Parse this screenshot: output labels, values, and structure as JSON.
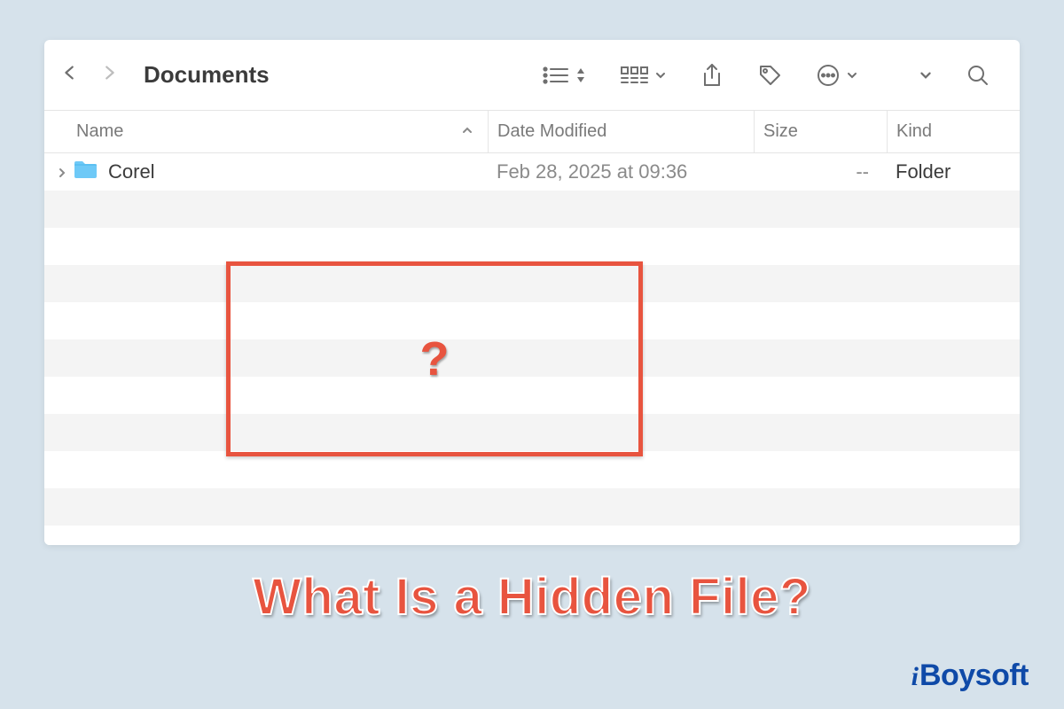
{
  "toolbar": {
    "title": "Documents"
  },
  "columns": {
    "name": "Name",
    "date": "Date Modified",
    "size": "Size",
    "kind": "Kind"
  },
  "rows": [
    {
      "name": "Corel",
      "date_modified": "Feb 28, 2025 at 09:36",
      "size": "--",
      "kind": "Folder"
    }
  ],
  "annotation": {
    "question_mark": "?",
    "caption": "What Is a Hidden File?"
  },
  "brand": {
    "prefix": "i",
    "rest": "Boysoft"
  }
}
